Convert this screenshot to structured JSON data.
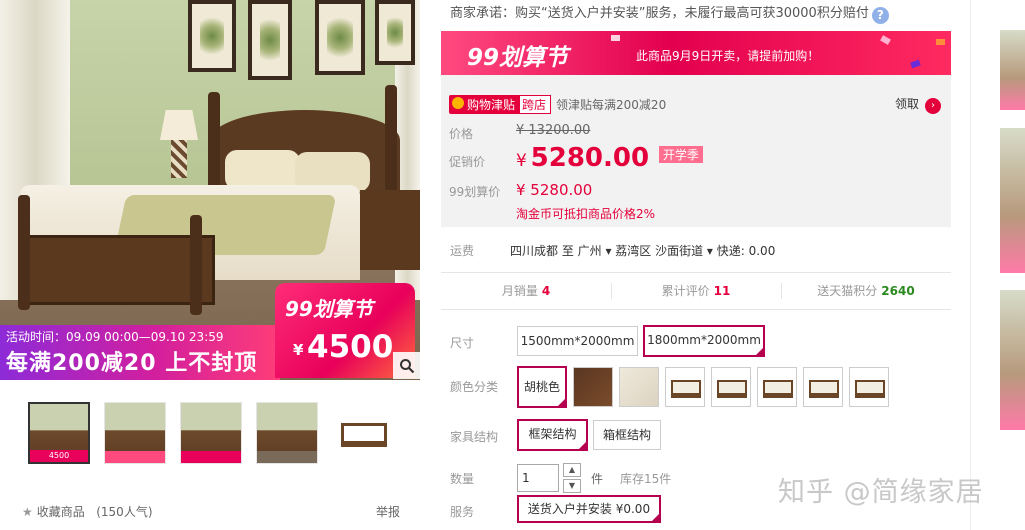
{
  "gallery": {
    "badge_logo": "99划算节",
    "badge_currency": "¥",
    "badge_amount": "4500",
    "activity_time": "活动时间：09.09 00:00—09.10 23:59",
    "slogan": "每满200减20 上不封顶",
    "thumb_tag": "4500",
    "thumb_count": 5
  },
  "footer": {
    "favorite_label": "收藏商品",
    "favorite_count": "(150人气)",
    "report_label": "举报"
  },
  "promise": {
    "text": "商家承诺：购买“送货入户并安装”服务，未履行最高可获30000积分赔付",
    "help_icon": "?"
  },
  "banner": {
    "logo": "99划算节",
    "note": "此商品9月9日开卖，请提前加购！"
  },
  "coupon": {
    "tag_primary": "购物津贴",
    "tag_secondary": "跨店",
    "text": "领津贴每满200减20",
    "claim_label": "领取",
    "claim_icon": "›"
  },
  "price": {
    "original_label": "价格",
    "original_value": "¥ 13200.00",
    "promo_label": "促销价",
    "promo_currency": "¥",
    "promo_value": "5280.00",
    "promo_badge": "开学季",
    "calc_label": "99划算价",
    "calc_value": "¥ 5280.00",
    "coin_note": "淘金币可抵扣商品价格2%"
  },
  "shipping": {
    "label": "运费",
    "text": "四川成都  至  广州 ▾ 荔湾区 沙面街道 ▾  快递: 0.00"
  },
  "stats": [
    {
      "label": "月销量",
      "value": "4"
    },
    {
      "label": "累计评价",
      "value": "11"
    },
    {
      "label": "送天猫积分",
      "value": "2640"
    }
  ],
  "sku": {
    "size_label": "尺寸",
    "sizes": [
      "1500mm*2000mm",
      "1800mm*2000mm"
    ],
    "color_label": "颜色分类",
    "color_selected": "胡桃色",
    "structure_label": "家具结构",
    "structures": [
      "框架结构",
      "箱框结构"
    ],
    "qty_label": "数量",
    "qty_value": "1",
    "qty_unit": "件",
    "stock": "库存15件",
    "service_label": "服务",
    "service_option": "送货入户并安装 ¥0.00"
  },
  "watermark": "知乎 @简缘家居",
  "colors": {
    "accent": "#e4003a",
    "selected_border": "#b5004f",
    "banner_pink": "#e3004f",
    "points_green": "#2b8a1f"
  },
  "icons": {
    "zoom": "search-icon",
    "favorite": "star-icon",
    "claim": "arrow-right-icon",
    "qty_up": "caret-up-icon",
    "qty_down": "caret-down-icon"
  }
}
